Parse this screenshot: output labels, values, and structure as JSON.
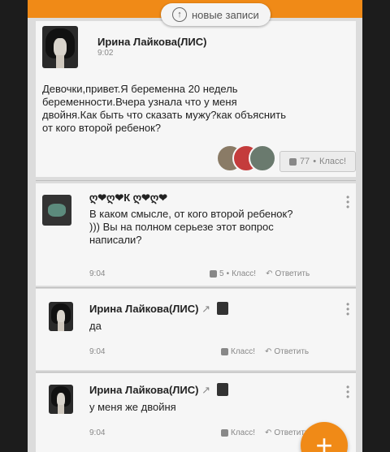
{
  "new_posts_label": "новые записи",
  "post": {
    "author": "Ирина Лайкова(ЛИС)",
    "time": "9:02",
    "lines": [
      "Девочки,привет.Я беременна 20 недель",
      "беременности.Вчера узнала что у меня",
      "двойня.Как быть что сказать мужу?как объяснить",
      "от кого второй ребенок?"
    ],
    "likes_count": "77",
    "like_label": "Класс!"
  },
  "comments": [
    {
      "author": "ღ❤ღ❤К ღ❤ღ❤",
      "lines": [
        "В каком смысле,  от кого второй ребенок?",
        ")))  Вы на полном серьезе этот вопрос",
        "написали?"
      ],
      "time": "9:04",
      "likes_count": "5",
      "like_label": "Класс!",
      "reply_label": "Ответить"
    },
    {
      "author": "Ирина Лайкова(ЛИС)",
      "lines": [
        "да"
      ],
      "time": "9:04",
      "like_label": "Класс!",
      "reply_label": "Ответить"
    },
    {
      "author": "Ирина Лайкова(ЛИС)",
      "lines": [
        "у меня же двойня"
      ],
      "time": "9:04",
      "like_label": "Класс!",
      "reply_label": "Ответить"
    }
  ],
  "fab_label": "+",
  "colors": {
    "accent": "#f08a17",
    "card": "#f6f6f6",
    "background": "#dcdcdc"
  }
}
